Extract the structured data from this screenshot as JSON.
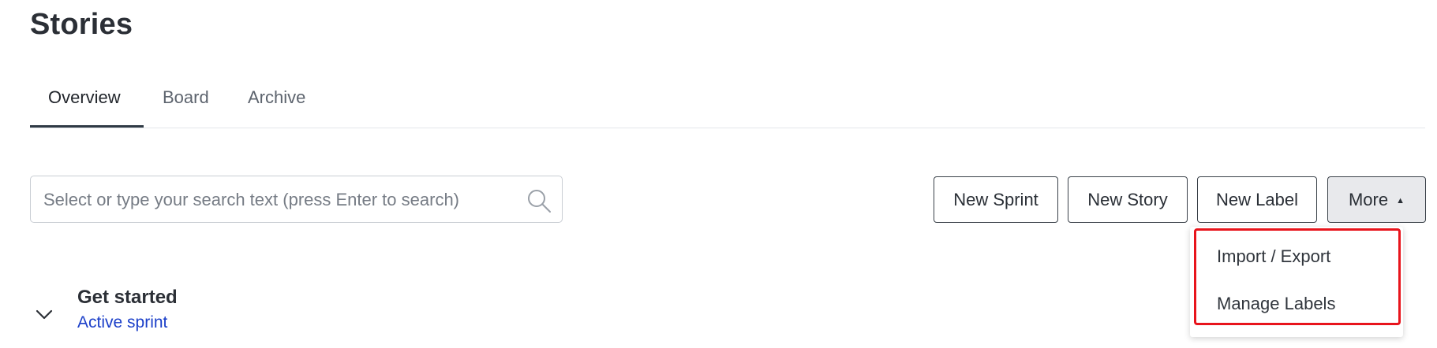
{
  "page": {
    "title": "Stories"
  },
  "tabs": [
    {
      "label": "Overview",
      "active": true
    },
    {
      "label": "Board",
      "active": false
    },
    {
      "label": "Archive",
      "active": false
    }
  ],
  "search": {
    "placeholder": "Select or type your search text (press Enter to search)",
    "value": "",
    "icon": "search-icon"
  },
  "toolbar": {
    "new_sprint": "New Sprint",
    "new_story": "New Story",
    "new_label": "New Label",
    "more": "More"
  },
  "more_menu": {
    "open": true,
    "items": [
      {
        "label": "Import / Export"
      },
      {
        "label": "Manage Labels"
      }
    ]
  },
  "section": {
    "title": "Get started",
    "subtitle": "Active sprint",
    "expanded": true,
    "icon": "chevron-down-icon"
  },
  "colors": {
    "accent_link": "#1b3fc9",
    "highlight": "#e8141c",
    "tab_underline": "#2f3a45"
  }
}
